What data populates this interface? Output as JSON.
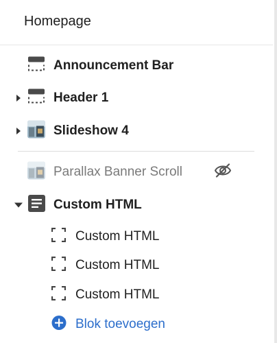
{
  "header": {
    "title": "Homepage"
  },
  "sections": [
    {
      "label": "Announcement Bar",
      "icon": "section-layout-icon"
    },
    {
      "label": "Header 1",
      "icon": "section-layout-icon"
    },
    {
      "label": "Slideshow 4",
      "icon": "image-thumbnail-icon"
    },
    {
      "label": "Parallax Banner Scroll",
      "icon": "image-thumbnail-icon",
      "hidden": true
    },
    {
      "label": "Custom HTML",
      "icon": "document-icon"
    }
  ],
  "blocks": [
    {
      "label": "Custom HTML",
      "icon": "block-frame-icon"
    },
    {
      "label": "Custom HTML",
      "icon": "block-frame-icon"
    },
    {
      "label": "Custom HTML",
      "icon": "block-frame-icon"
    }
  ],
  "add_block": {
    "label": "Blok toevoegen",
    "icon": "plus-circle-icon"
  },
  "colors": {
    "accent": "#2c6ecb",
    "muted_text": "#7a7a7a",
    "text": "#202020"
  }
}
